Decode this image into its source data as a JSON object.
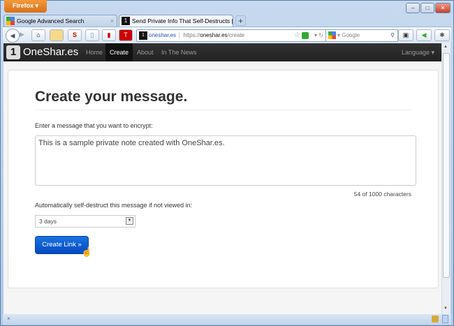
{
  "window": {
    "app_button": "Firefox ▾",
    "minimize": "–",
    "maximize": "□",
    "close": "✕"
  },
  "tabs": [
    {
      "label": "Google Advanced Search",
      "close": "×"
    },
    {
      "label": "Send Private Info That Self-Destructs |...",
      "close": "×"
    }
  ],
  "new_tab": "+",
  "toolbar": {
    "back": "◀",
    "forward": "▶",
    "home": "⌂",
    "identity": "oneshar.es",
    "url_prefix": "https://",
    "url_host": "oneshar.es",
    "url_path": "/create",
    "search_placeholder": "Google"
  },
  "site": {
    "brand": "OneShar.es",
    "logo": "1",
    "nav": [
      "Home",
      "Create",
      "About",
      "In The News"
    ],
    "active_nav": "Create",
    "language": "Language ▾"
  },
  "form": {
    "title": "Create your message.",
    "message_label": "Enter a message that you want to encrypt:",
    "message_value": "This is a sample private note created with OneShar.es.",
    "char_count": "54 of 1000 characters",
    "expiry_label": "Automatically self-destruct this message if not viewed in:",
    "expiry_value": "3 days",
    "submit": "Create Link »"
  },
  "colors": {
    "accent": "#0a5fd6",
    "navbar": "#222222"
  }
}
